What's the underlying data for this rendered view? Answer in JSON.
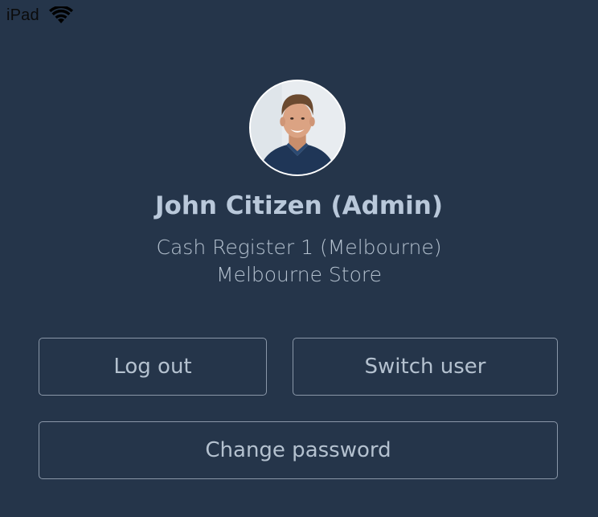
{
  "status_bar": {
    "device": "iPad",
    "wifi_icon": "wifi-icon"
  },
  "profile": {
    "avatar_icon": "user-photo",
    "name": "John Citizen (Admin)",
    "register": "Cash Register 1 (Melbourne)",
    "store": "Melbourne Store"
  },
  "actions": {
    "logout_label": "Log out",
    "switch_user_label": "Switch user",
    "change_password_label": "Change password"
  },
  "colors": {
    "background": "#25354a",
    "text": "#b4c1cf",
    "border": "#8a97a8"
  }
}
